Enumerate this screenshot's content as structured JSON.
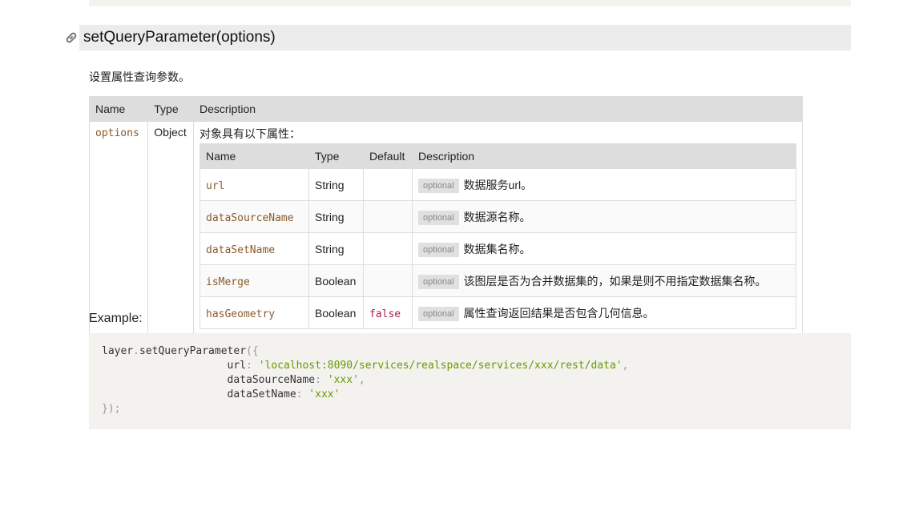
{
  "method": {
    "name": "setQueryParameter(options)",
    "description": "设置属性查询参数。"
  },
  "params_table": {
    "headers": [
      "Name",
      "Type",
      "Description"
    ],
    "row": {
      "name": "options",
      "type": "Object",
      "description": "对象具有以下属性："
    },
    "inner_headers": [
      "Name",
      "Type",
      "Default",
      "Description"
    ],
    "properties": [
      {
        "name": "url",
        "type": "String",
        "default": "",
        "tag": "optional",
        "desc": "数据服务url。"
      },
      {
        "name": "dataSourceName",
        "type": "String",
        "default": "",
        "tag": "optional",
        "desc": "数据源名称。"
      },
      {
        "name": "dataSetName",
        "type": "String",
        "default": "",
        "tag": "optional",
        "desc": "数据集名称。"
      },
      {
        "name": "isMerge",
        "type": "Boolean",
        "default": "",
        "tag": "optional",
        "desc": "该图层是否为合并数据集的，如果是则不用指定数据集名称。"
      },
      {
        "name": "hasGeometry",
        "type": "Boolean",
        "default": "false",
        "tag": "optional",
        "desc": "属性查询返回结果是否包含几何信息。"
      }
    ]
  },
  "example": {
    "label": "Example:",
    "code": {
      "obj": "layer",
      "dot": ".",
      "fn": "setQueryParameter",
      "open": "({",
      "k1": "url",
      "v1": "'localhost:8090/services/realspace/services/xxx/rest/data'",
      "k2": "dataSourceName",
      "v2": "'xxx'",
      "k3": "dataSetName",
      "v3": "'xxx'",
      "colon": ":",
      "comma": ",",
      "close": "});"
    }
  },
  "colors": {
    "header_bg": "#ececec",
    "code_bg": "#f4f2ef",
    "param_name": "#8a5a2b",
    "string": "#669900",
    "default_value": "#b0204a"
  },
  "icons": {
    "anchor": "link-icon"
  }
}
